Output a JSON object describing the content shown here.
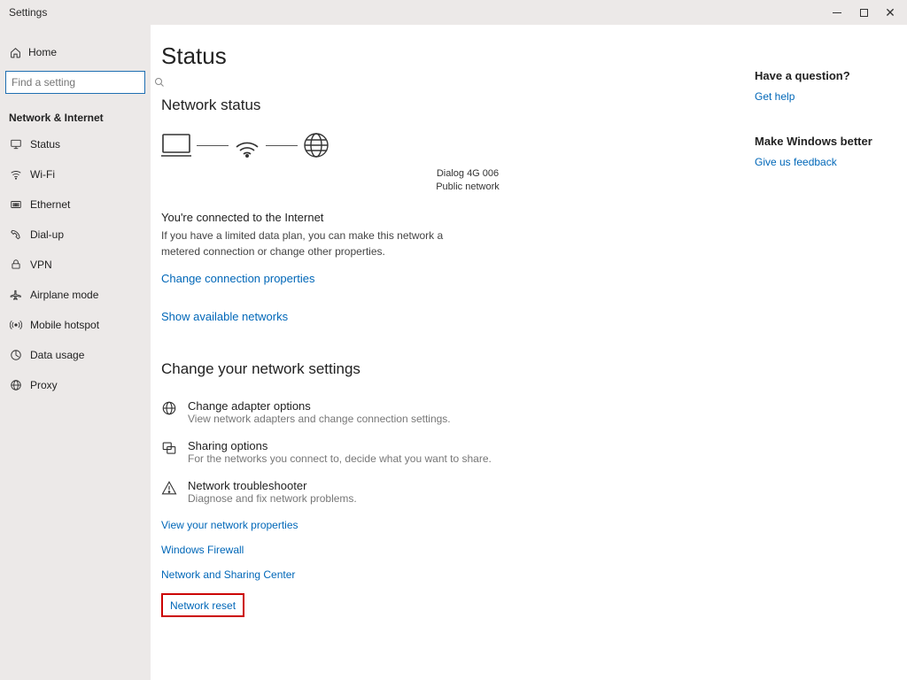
{
  "titlebar": {
    "app_name": "Settings"
  },
  "sidebar": {
    "home_label": "Home",
    "search_placeholder": "Find a setting",
    "category": "Network & Internet",
    "items": [
      {
        "label": "Status"
      },
      {
        "label": "Wi-Fi"
      },
      {
        "label": "Ethernet"
      },
      {
        "label": "Dial-up"
      },
      {
        "label": "VPN"
      },
      {
        "label": "Airplane mode"
      },
      {
        "label": "Mobile hotspot"
      },
      {
        "label": "Data usage"
      },
      {
        "label": "Proxy"
      }
    ]
  },
  "main": {
    "page_title": "Status",
    "network_status_heading": "Network status",
    "connection_name": "Dialog 4G 006",
    "connection_type": "Public network",
    "connected_title": "You're connected to the Internet",
    "connected_body": "If you have a limited data plan, you can make this network a metered connection or change other properties.",
    "change_conn_props": "Change connection properties",
    "show_networks": "Show available networks",
    "change_settings_heading": "Change your network settings",
    "options": [
      {
        "title": "Change adapter options",
        "desc": "View network adapters and change connection settings."
      },
      {
        "title": "Sharing options",
        "desc": "For the networks you connect to, decide what you want to share."
      },
      {
        "title": "Network troubleshooter",
        "desc": "Diagnose and fix network problems."
      }
    ],
    "links": [
      "View your network properties",
      "Windows Firewall",
      "Network and Sharing Center",
      "Network reset"
    ]
  },
  "aside": {
    "question_heading": "Have a question?",
    "get_help": "Get help",
    "better_heading": "Make Windows better",
    "feedback": "Give us feedback"
  }
}
